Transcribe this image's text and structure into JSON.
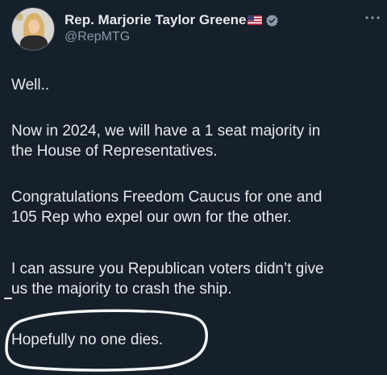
{
  "author": {
    "display_name": "Rep. Marjorie Taylor Greene",
    "handle": "@RepMTG",
    "flag_icon": "us-flag-icon",
    "verified_icon": "verified-badge-icon",
    "verified_color": "#8b98a5"
  },
  "tweet": {
    "paragraphs": [
      "Well..",
      "Now in 2024, we will have a 1 seat majority in\nthe House of Representatives.",
      "Congratulations Freedom Caucus for one and\n105 Rep who expel our own for the other.",
      "I can assure you Republican voters didn’t give\nus the majority to crash the ship.",
      "Hopefully no one dies."
    ]
  },
  "colors": {
    "background": "#15202b",
    "text": "#e7e9ea",
    "secondary_text": "#8b98a5",
    "annotation_stroke": "#ffffff"
  },
  "icons": {
    "more": "more-options-icon"
  }
}
